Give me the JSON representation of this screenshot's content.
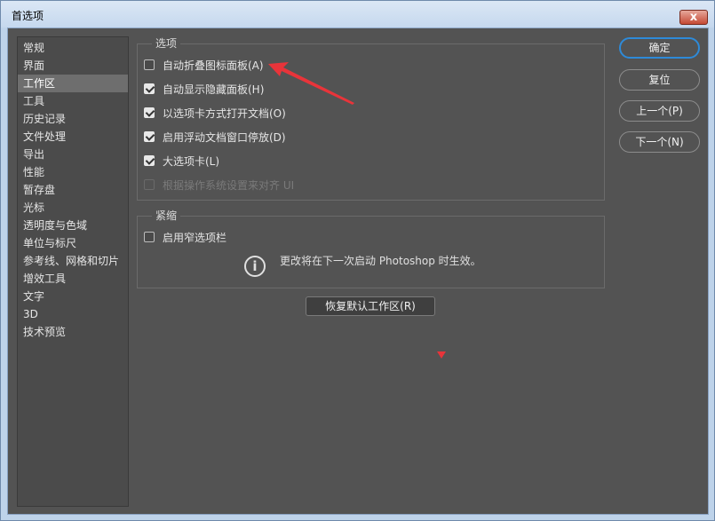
{
  "window": {
    "title": "首选项",
    "close_label": "x"
  },
  "sidebar": {
    "items": [
      {
        "label": "常规"
      },
      {
        "label": "界面"
      },
      {
        "label": "工作区",
        "active": true
      },
      {
        "label": "工具"
      },
      {
        "label": "历史记录"
      },
      {
        "label": "文件处理"
      },
      {
        "label": "导出"
      },
      {
        "label": "性能"
      },
      {
        "label": "暂存盘"
      },
      {
        "label": "光标"
      },
      {
        "label": "透明度与色域"
      },
      {
        "label": "单位与标尺"
      },
      {
        "label": "参考线、网格和切片"
      },
      {
        "label": "增效工具"
      },
      {
        "label": "文字"
      },
      {
        "label": "3D"
      },
      {
        "label": "技术预览"
      }
    ]
  },
  "options_group": {
    "title": "选项",
    "options": [
      {
        "label": "自动折叠图标面板(A)",
        "checked": false,
        "enabled": true
      },
      {
        "label": "自动显示隐藏面板(H)",
        "checked": true,
        "enabled": true
      },
      {
        "label": "以选项卡方式打开文档(O)",
        "checked": true,
        "enabled": true
      },
      {
        "label": "启用浮动文档窗口停放(D)",
        "checked": true,
        "enabled": true
      },
      {
        "label": "大选项卡(L)",
        "checked": true,
        "enabled": true
      },
      {
        "label": "根据操作系统设置来对齐 UI",
        "checked": false,
        "enabled": false
      }
    ]
  },
  "compact_group": {
    "title": "紧缩",
    "option": {
      "label": "启用窄选项栏",
      "checked": false
    },
    "info_icon": "i",
    "info_text": "更改将在下一次启动 Photoshop 时生效。"
  },
  "restore_button": "恢复默认工作区(R)",
  "buttons": {
    "ok": "确定",
    "reset": "复位",
    "prev": "上一个(P)",
    "next": "下一个(N)"
  },
  "colors": {
    "annotation_arrow": "#e8343a",
    "primary_button_border": "#2e8ad8"
  }
}
